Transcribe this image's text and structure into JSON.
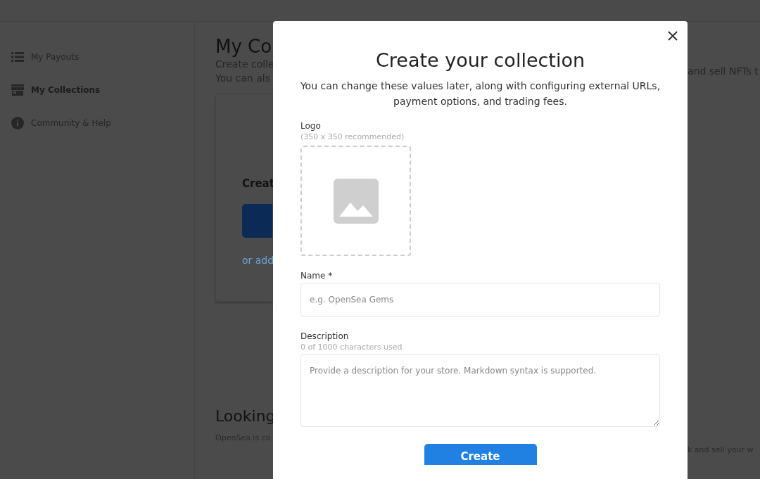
{
  "sidebar": {
    "items": [
      {
        "label": "My Payouts",
        "kind": "list",
        "selected": false
      },
      {
        "label": "My Collections",
        "kind": "store",
        "selected": true
      },
      {
        "label": "Community & Help",
        "kind": "info",
        "selected": false
      }
    ]
  },
  "page": {
    "title": "My Co",
    "intro_left": [
      "Create colle",
      "You can als"
    ],
    "intro_right": "and sell NFTs t",
    "card_title": "Creat",
    "card_link": "or add",
    "section_title": "Looking",
    "section_text_left": "OpenSea is co",
    "section_text_right": "k and sell your w"
  },
  "modal": {
    "title": "Create your collection",
    "subtitle": "You can change these values later, along with configuring external URLs, payment options, and trading fees.",
    "logo": {
      "label": "Logo",
      "hint": "(350 x 350 recommended)"
    },
    "name": {
      "label": "Name *",
      "placeholder": "e.g. OpenSea Gems"
    },
    "description": {
      "label": "Description",
      "counter": "0 of 1000 characters used",
      "placeholder": "Provide a description for your store. Markdown syntax is supported."
    },
    "submit": "Create"
  }
}
